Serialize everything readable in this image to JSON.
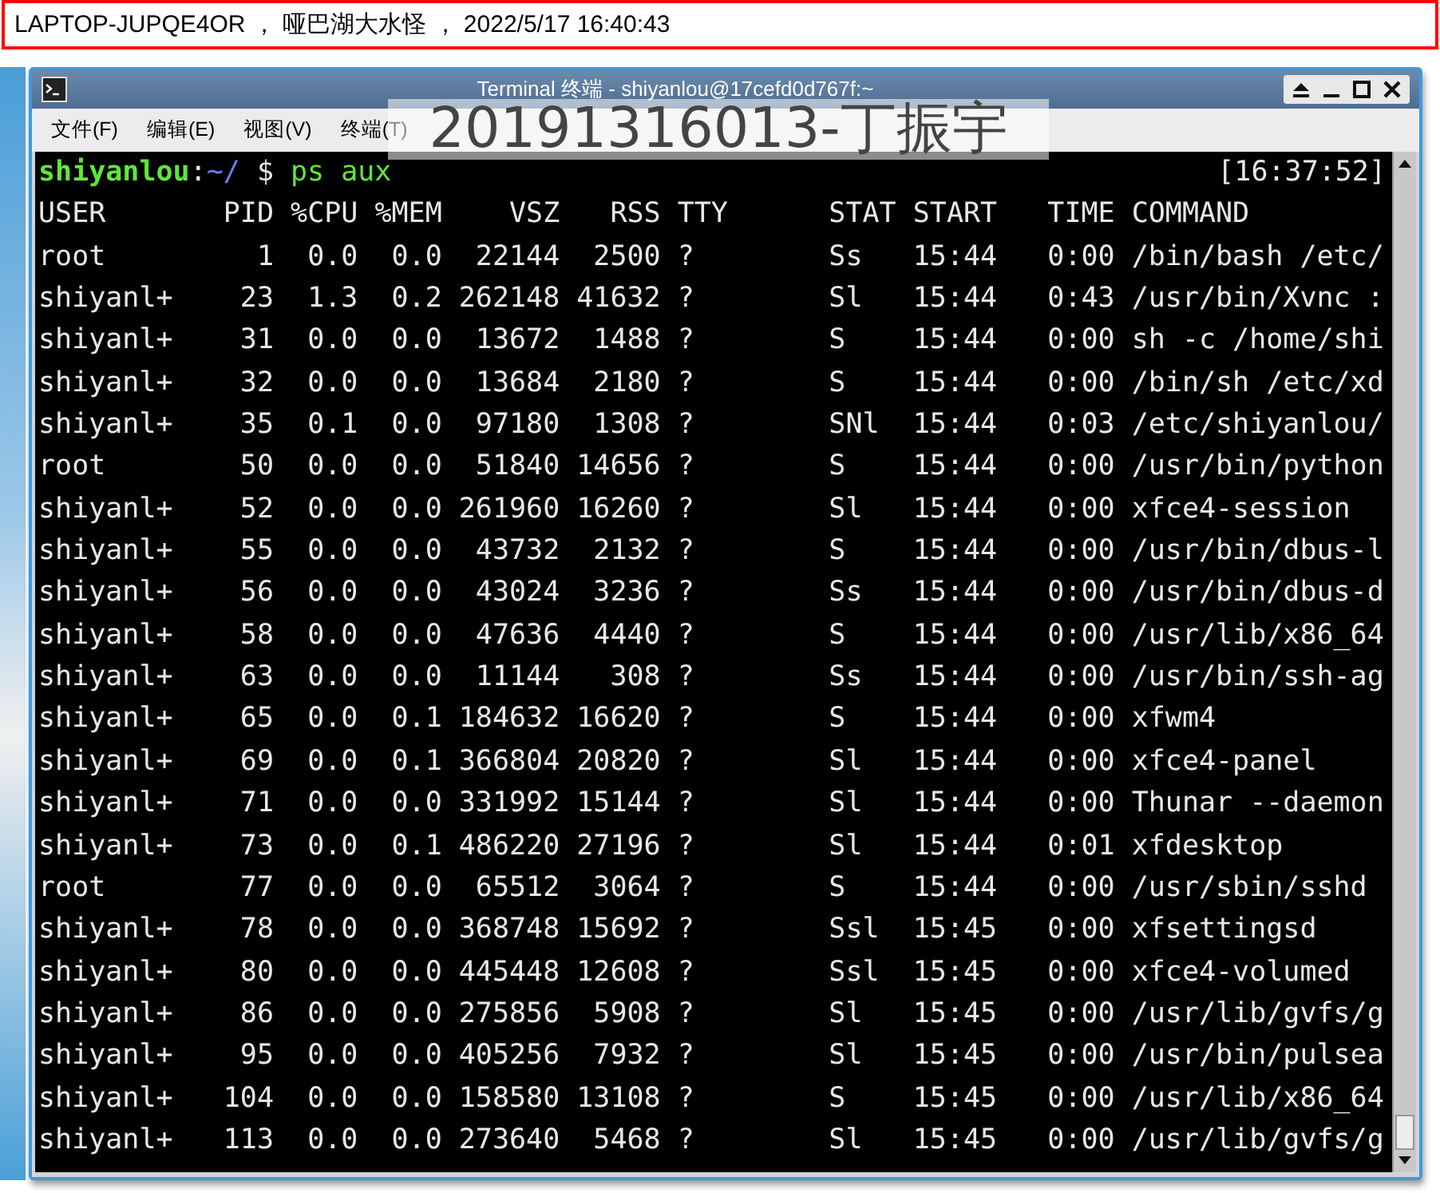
{
  "caption_bar": {
    "text": "LAPTOP-JUPQE4OR ， 哑巴湖大水怪 ， 2022/5/17 16:40:43"
  },
  "window": {
    "title": "Terminal 终端 - shiyanlou@17cefd0d767f:~"
  },
  "menu": [
    "文件(F)",
    "编辑(E)",
    "视图(V)",
    "终端(T)"
  ],
  "overlay_label": "20191316013-丁振宇",
  "prompt": {
    "user": "shiyanlou",
    "separator": ":",
    "path": "~/",
    "symbol": "$",
    "command": "ps aux",
    "clock": "[16:37:52]"
  },
  "table": {
    "columns": [
      "USER",
      "PID",
      "%CPU",
      "%MEM",
      "VSZ",
      "RSS",
      "TTY",
      "STAT",
      "START",
      "TIME",
      "COMMAND"
    ],
    "rows": [
      [
        "root",
        "1",
        "0.0",
        "0.0",
        "22144",
        "2500",
        "?",
        "Ss",
        "15:44",
        "0:00",
        "/bin/bash /etc/"
      ],
      [
        "shiyanl+",
        "23",
        "1.3",
        "0.2",
        "262148",
        "41632",
        "?",
        "Sl",
        "15:44",
        "0:43",
        "/usr/bin/Xvnc :"
      ],
      [
        "shiyanl+",
        "31",
        "0.0",
        "0.0",
        "13672",
        "1488",
        "?",
        "S",
        "15:44",
        "0:00",
        "sh -c /home/shi"
      ],
      [
        "shiyanl+",
        "32",
        "0.0",
        "0.0",
        "13684",
        "2180",
        "?",
        "S",
        "15:44",
        "0:00",
        "/bin/sh /etc/xd"
      ],
      [
        "shiyanl+",
        "35",
        "0.1",
        "0.0",
        "97180",
        "1308",
        "?",
        "SNl",
        "15:44",
        "0:03",
        "/etc/shiyanlou/"
      ],
      [
        "root",
        "50",
        "0.0",
        "0.0",
        "51840",
        "14656",
        "?",
        "S",
        "15:44",
        "0:00",
        "/usr/bin/python"
      ],
      [
        "shiyanl+",
        "52",
        "0.0",
        "0.0",
        "261960",
        "16260",
        "?",
        "Sl",
        "15:44",
        "0:00",
        "xfce4-session"
      ],
      [
        "shiyanl+",
        "55",
        "0.0",
        "0.0",
        "43732",
        "2132",
        "?",
        "S",
        "15:44",
        "0:00",
        "/usr/bin/dbus-l"
      ],
      [
        "shiyanl+",
        "56",
        "0.0",
        "0.0",
        "43024",
        "3236",
        "?",
        "Ss",
        "15:44",
        "0:00",
        "/usr/bin/dbus-d"
      ],
      [
        "shiyanl+",
        "58",
        "0.0",
        "0.0",
        "47636",
        "4440",
        "?",
        "S",
        "15:44",
        "0:00",
        "/usr/lib/x86_64"
      ],
      [
        "shiyanl+",
        "63",
        "0.0",
        "0.0",
        "11144",
        "308",
        "?",
        "Ss",
        "15:44",
        "0:00",
        "/usr/bin/ssh-ag"
      ],
      [
        "shiyanl+",
        "65",
        "0.0",
        "0.1",
        "184632",
        "16620",
        "?",
        "S",
        "15:44",
        "0:00",
        "xfwm4"
      ],
      [
        "shiyanl+",
        "69",
        "0.0",
        "0.1",
        "366804",
        "20820",
        "?",
        "Sl",
        "15:44",
        "0:00",
        "xfce4-panel"
      ],
      [
        "shiyanl+",
        "71",
        "0.0",
        "0.0",
        "331992",
        "15144",
        "?",
        "Sl",
        "15:44",
        "0:00",
        "Thunar --daemon"
      ],
      [
        "shiyanl+",
        "73",
        "0.0",
        "0.1",
        "486220",
        "27196",
        "?",
        "Sl",
        "15:44",
        "0:01",
        "xfdesktop"
      ],
      [
        "root",
        "77",
        "0.0",
        "0.0",
        "65512",
        "3064",
        "?",
        "S",
        "15:44",
        "0:00",
        "/usr/sbin/sshd"
      ],
      [
        "shiyanl+",
        "78",
        "0.0",
        "0.0",
        "368748",
        "15692",
        "?",
        "Ssl",
        "15:45",
        "0:00",
        "xfsettingsd"
      ],
      [
        "shiyanl+",
        "80",
        "0.0",
        "0.0",
        "445448",
        "12608",
        "?",
        "Ssl",
        "15:45",
        "0:00",
        "xfce4-volumed"
      ],
      [
        "shiyanl+",
        "86",
        "0.0",
        "0.0",
        "275856",
        "5908",
        "?",
        "Sl",
        "15:45",
        "0:00",
        "/usr/lib/gvfs/g"
      ],
      [
        "shiyanl+",
        "95",
        "0.0",
        "0.0",
        "405256",
        "7932",
        "?",
        "Sl",
        "15:45",
        "0:00",
        "/usr/bin/pulsea"
      ],
      [
        "shiyanl+",
        "104",
        "0.0",
        "0.0",
        "158580",
        "13108",
        "?",
        "S",
        "15:45",
        "0:00",
        "/usr/lib/x86_64"
      ],
      [
        "shiyanl+",
        "113",
        "0.0",
        "0.0",
        "273640",
        "5468",
        "?",
        "Sl",
        "15:45",
        "0:00",
        "/usr/lib/gvfs/g"
      ]
    ]
  }
}
